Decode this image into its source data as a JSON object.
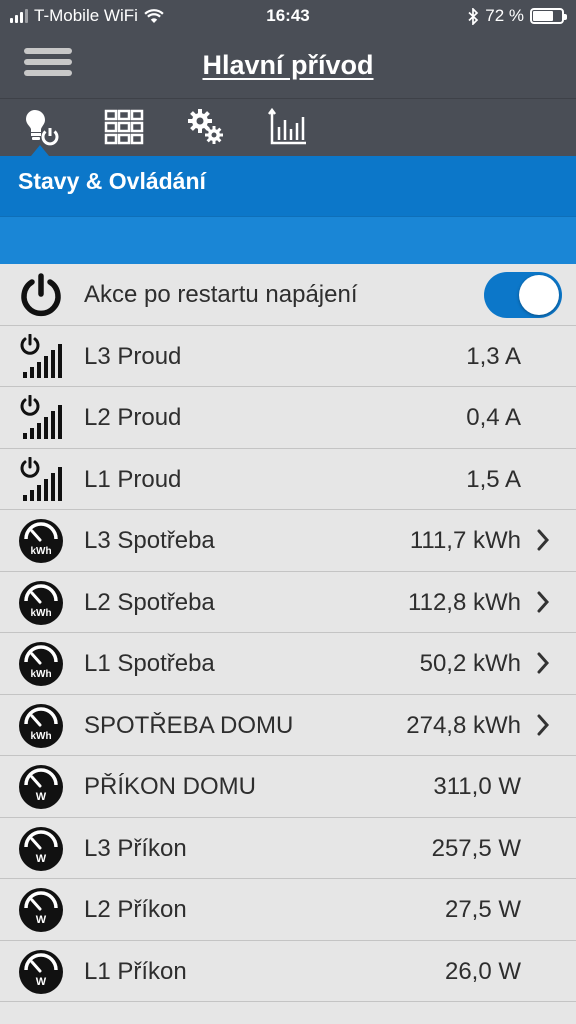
{
  "status_bar": {
    "carrier": "T-Mobile WiFi",
    "time": "16:43",
    "battery": "72 %",
    "battery_level": 0.72
  },
  "nav": {
    "title": "Hlavní přívod",
    "menu_icon": "hamburger-icon"
  },
  "tabs": [
    {
      "icon": "bulb-power-icon",
      "active": true
    },
    {
      "icon": "grid-icon",
      "active": false
    },
    {
      "icon": "gears-icon",
      "active": false
    },
    {
      "icon": "chart-icon",
      "active": false
    }
  ],
  "section": {
    "title": "Stavy & Ovládání"
  },
  "toggle_row": {
    "label": "Akce po restartu napájení",
    "on": true
  },
  "rows": [
    {
      "icon": "power-signal-icon",
      "label": "L3  Proud",
      "value": "1,3 A",
      "chevron": false
    },
    {
      "icon": "power-signal-icon",
      "label": "L2  Proud",
      "value": "0,4 A",
      "chevron": false
    },
    {
      "icon": "power-signal-icon",
      "label": "L1  Proud",
      "value": "1,5 A",
      "chevron": false
    },
    {
      "icon": "gauge-kwh-icon",
      "label": "L3  Spotřeba",
      "value": "111,7 kWh",
      "chevron": true,
      "gauge_text": "kWh"
    },
    {
      "icon": "gauge-kwh-icon",
      "label": "L2  Spotřeba",
      "value": "112,8 kWh",
      "chevron": true,
      "gauge_text": "kWh"
    },
    {
      "icon": "gauge-kwh-icon",
      "label": "L1  Spotřeba",
      "value": "50,2 kWh",
      "chevron": true,
      "gauge_text": "kWh"
    },
    {
      "icon": "gauge-kwh-icon",
      "label": "SPOTŘEBA DOMU",
      "value": "274,8 kWh",
      "chevron": true,
      "gauge_text": "kWh"
    },
    {
      "icon": "gauge-w-icon",
      "label": "PŘÍKON DOMU",
      "value": "311,0 W",
      "chevron": false,
      "gauge_text": "W"
    },
    {
      "icon": "gauge-w-icon",
      "label": "L3  Příkon",
      "value": "257,5 W",
      "chevron": false,
      "gauge_text": "W"
    },
    {
      "icon": "gauge-w-icon",
      "label": "L2  Příkon",
      "value": "27,5 W",
      "chevron": false,
      "gauge_text": "W"
    },
    {
      "icon": "gauge-w-icon",
      "label": "L1  Příkon",
      "value": "26,0 W",
      "chevron": false,
      "gauge_text": "W"
    }
  ],
  "colors": {
    "bar_bg": "#4a4e56",
    "accent": "#0c77c9",
    "list_bg": "#e6e6e6"
  }
}
